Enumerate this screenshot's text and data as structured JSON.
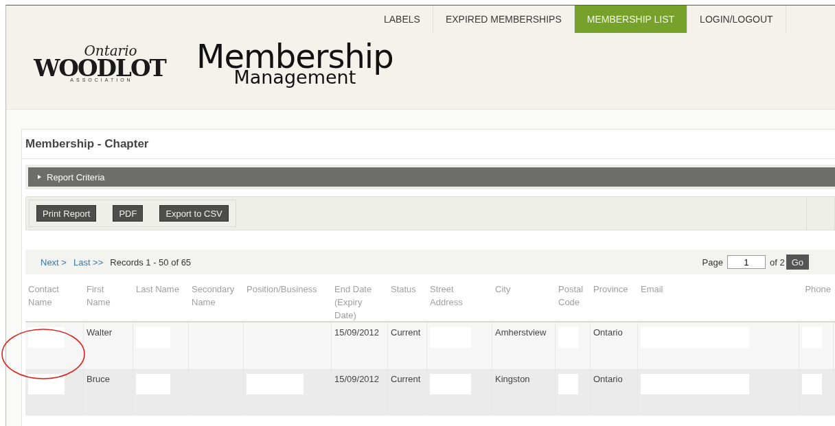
{
  "nav": [
    {
      "label": "LABELS",
      "selected": false
    },
    {
      "label": "EXPIRED MEMBERSHIPS",
      "selected": false
    },
    {
      "label": "MEMBERSHIP LIST",
      "selected": true
    },
    {
      "label": "LOGIN/LOGOUT",
      "selected": false
    }
  ],
  "logo": {
    "script": "Ontario",
    "name": "WOODLOT",
    "sub": "ASSOCIATION"
  },
  "app_title": {
    "main": "Membership",
    "sub": "Management"
  },
  "page_title": "Membership - Chapter",
  "criteria": {
    "label": "Report Criteria",
    "expanded": false
  },
  "toolbar": [
    "Print Report",
    "PDF",
    "Export to CSV"
  ],
  "pager": {
    "next": "Next >",
    "last": "Last >>",
    "records": "Records 1 - 50 of 65",
    "page_label": "Page",
    "page": "1",
    "of": "of 2",
    "go": "Go"
  },
  "table": {
    "columns": [
      "Contact Name",
      "First Name",
      "Last Name",
      "Secondary Name",
      "Position/Business",
      "End Date (Expiry Date)",
      "Status",
      "Street Address",
      "City",
      "Postal Code",
      "Province",
      "Email",
      "Phone"
    ],
    "rows": [
      {
        "cells": [
          {
            "kind": "redacted"
          },
          {
            "kind": "text",
            "text": "Walter"
          },
          {
            "kind": "redacted"
          },
          {
            "kind": "empty"
          },
          {
            "kind": "empty"
          },
          {
            "kind": "text",
            "text": "15/09/2012"
          },
          {
            "kind": "text",
            "text": "Current"
          },
          {
            "kind": "redacted"
          },
          {
            "kind": "text",
            "text": "Amherstview"
          },
          {
            "kind": "redacted"
          },
          {
            "kind": "text",
            "text": "Ontario"
          },
          {
            "kind": "redacted"
          },
          {
            "kind": "redacted"
          }
        ]
      },
      {
        "cells": [
          {
            "kind": "redacted"
          },
          {
            "kind": "text",
            "text": "Bruce"
          },
          {
            "kind": "redacted"
          },
          {
            "kind": "empty"
          },
          {
            "kind": "redacted"
          },
          {
            "kind": "text",
            "text": "15/09/2012"
          },
          {
            "kind": "text",
            "text": "Current"
          },
          {
            "kind": "redacted"
          },
          {
            "kind": "text",
            "text": "Kingston"
          },
          {
            "kind": "redacted"
          },
          {
            "kind": "text",
            "text": "Ontario"
          },
          {
            "kind": "redacted"
          },
          {
            "kind": "redacted"
          }
        ]
      }
    ]
  },
  "annotation": {
    "kind": "circle"
  }
}
